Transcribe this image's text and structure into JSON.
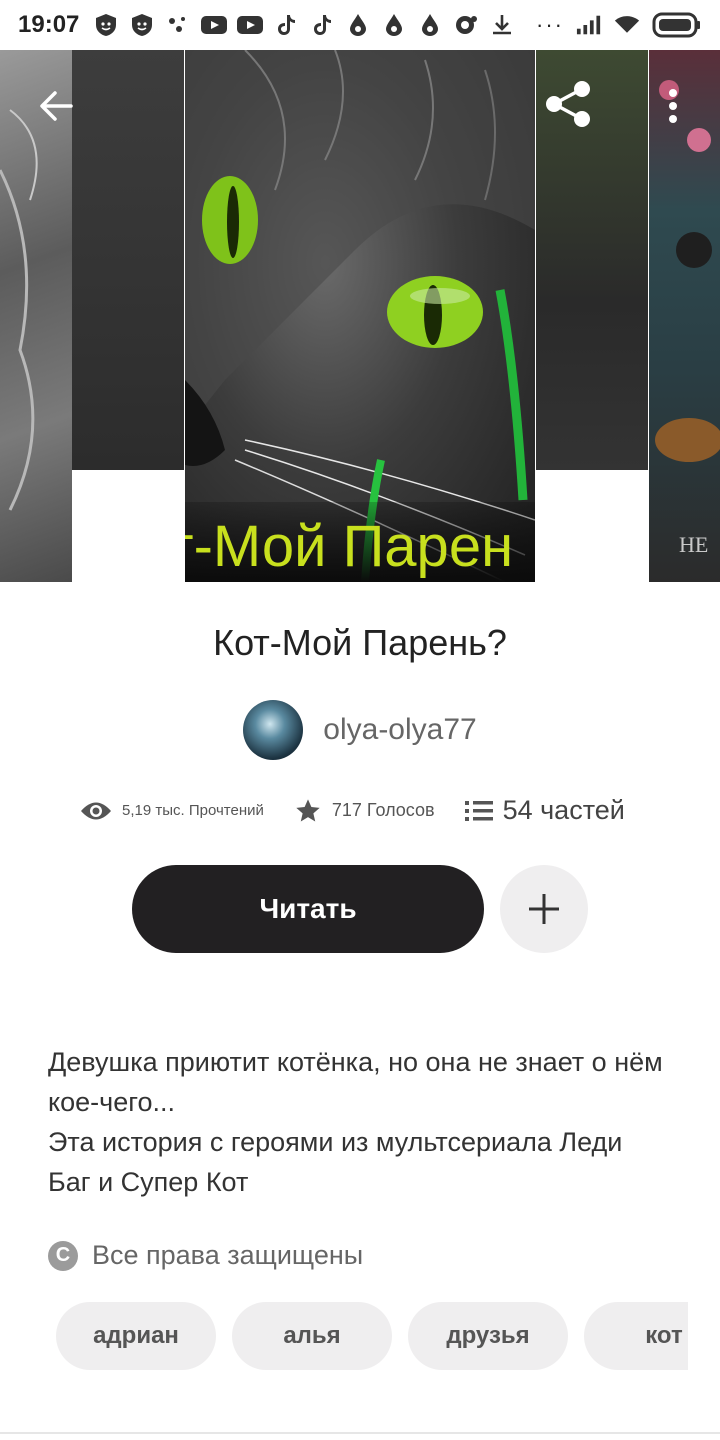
{
  "status_bar": {
    "time": "19:07",
    "dots": "···",
    "notification_icons": [
      "shield-icon",
      "shield-icon",
      "dots-icon",
      "youtube-icon",
      "youtube-icon",
      "tiktok-icon",
      "tiktok-icon",
      "drop-icon",
      "drop-icon",
      "drop-icon",
      "vpn-icon",
      "download-icon"
    ]
  },
  "header": {
    "back_icon": "arrow-left-icon",
    "share_icon": "share-icon",
    "menu_icon": "more-vertical-icon"
  },
  "carousel": {
    "main_cover_text": "т-Мой Парен",
    "right_cover_text": "НЕ"
  },
  "story": {
    "title": "Кот-Мой Парень?",
    "author": "olya-olya77",
    "reads": "5,19 тыс. Прочтений",
    "votes": "717 Голосов",
    "parts": "54 частей",
    "read_button": "Читать",
    "description_line1": "Девушка приютит котёнка, но она не знает о нём кое-чего...",
    "description_line2": "Эта история с героями из мультсериала Леди Баг и Супер Кот",
    "copyright_symbol": "C",
    "copyright": "Все права защищены",
    "tags": [
      "адриан",
      "алья",
      "друзья",
      "кот"
    ]
  },
  "colors": {
    "read_button_bg": "#222022",
    "chip_bg": "#efeeef",
    "cover_text": "#c8e01e"
  }
}
